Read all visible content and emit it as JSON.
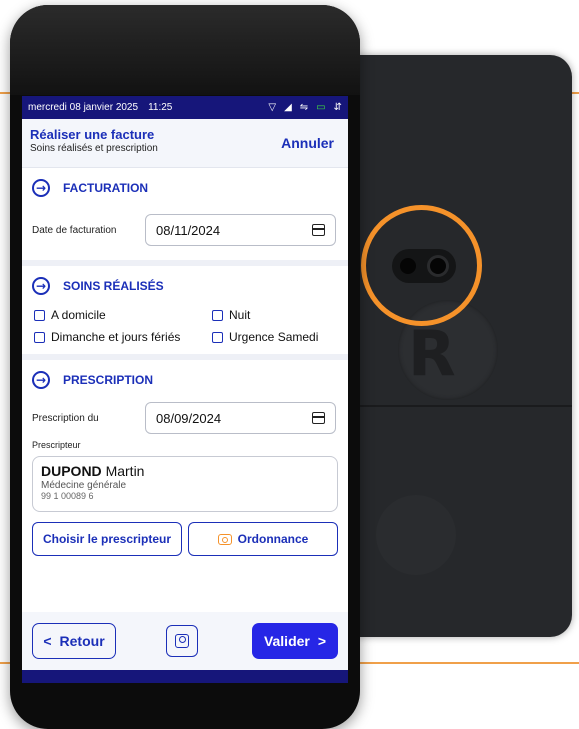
{
  "status_bar": {
    "date": "mercredi 08 janvier 2025",
    "time": "11:25",
    "icons": [
      "wifi-icon",
      "signal-icon",
      "usb-icon",
      "battery-icon",
      "data-icon"
    ]
  },
  "header": {
    "title": "Réaliser une facture",
    "subtitle": "Soins réalisés et prescription",
    "cancel_label": "Annuler"
  },
  "facturation": {
    "title": "FACTURATION",
    "date_label": "Date de facturation",
    "date_value": "08/11/2024"
  },
  "soins": {
    "title": "SOINS RÉALISÉS",
    "options": [
      {
        "label": "A domicile",
        "checked": false
      },
      {
        "label": "Nuit",
        "checked": false
      },
      {
        "label": "Dimanche et jours fériés",
        "checked": false
      },
      {
        "label": "Urgence Samedi",
        "checked": false
      }
    ]
  },
  "prescription": {
    "title": "PRESCRIPTION",
    "date_label": "Prescription du",
    "date_value": "08/09/2024",
    "prescriber_label": "Prescripteur",
    "prescriber": {
      "last_name": "DUPOND",
      "first_name": "Martin",
      "specialty": "Médecine générale",
      "number": "99 1 00089 6"
    },
    "choose_label": "Choisir le prescripteur",
    "ordonnance_label": "Ordonnance"
  },
  "footer": {
    "back_label": "Retour",
    "validate_label": "Valider"
  },
  "colors": {
    "primary": "#1b2fb8",
    "status_bar": "#16167a",
    "validate": "#2626e6",
    "accent": "#f5922a"
  }
}
